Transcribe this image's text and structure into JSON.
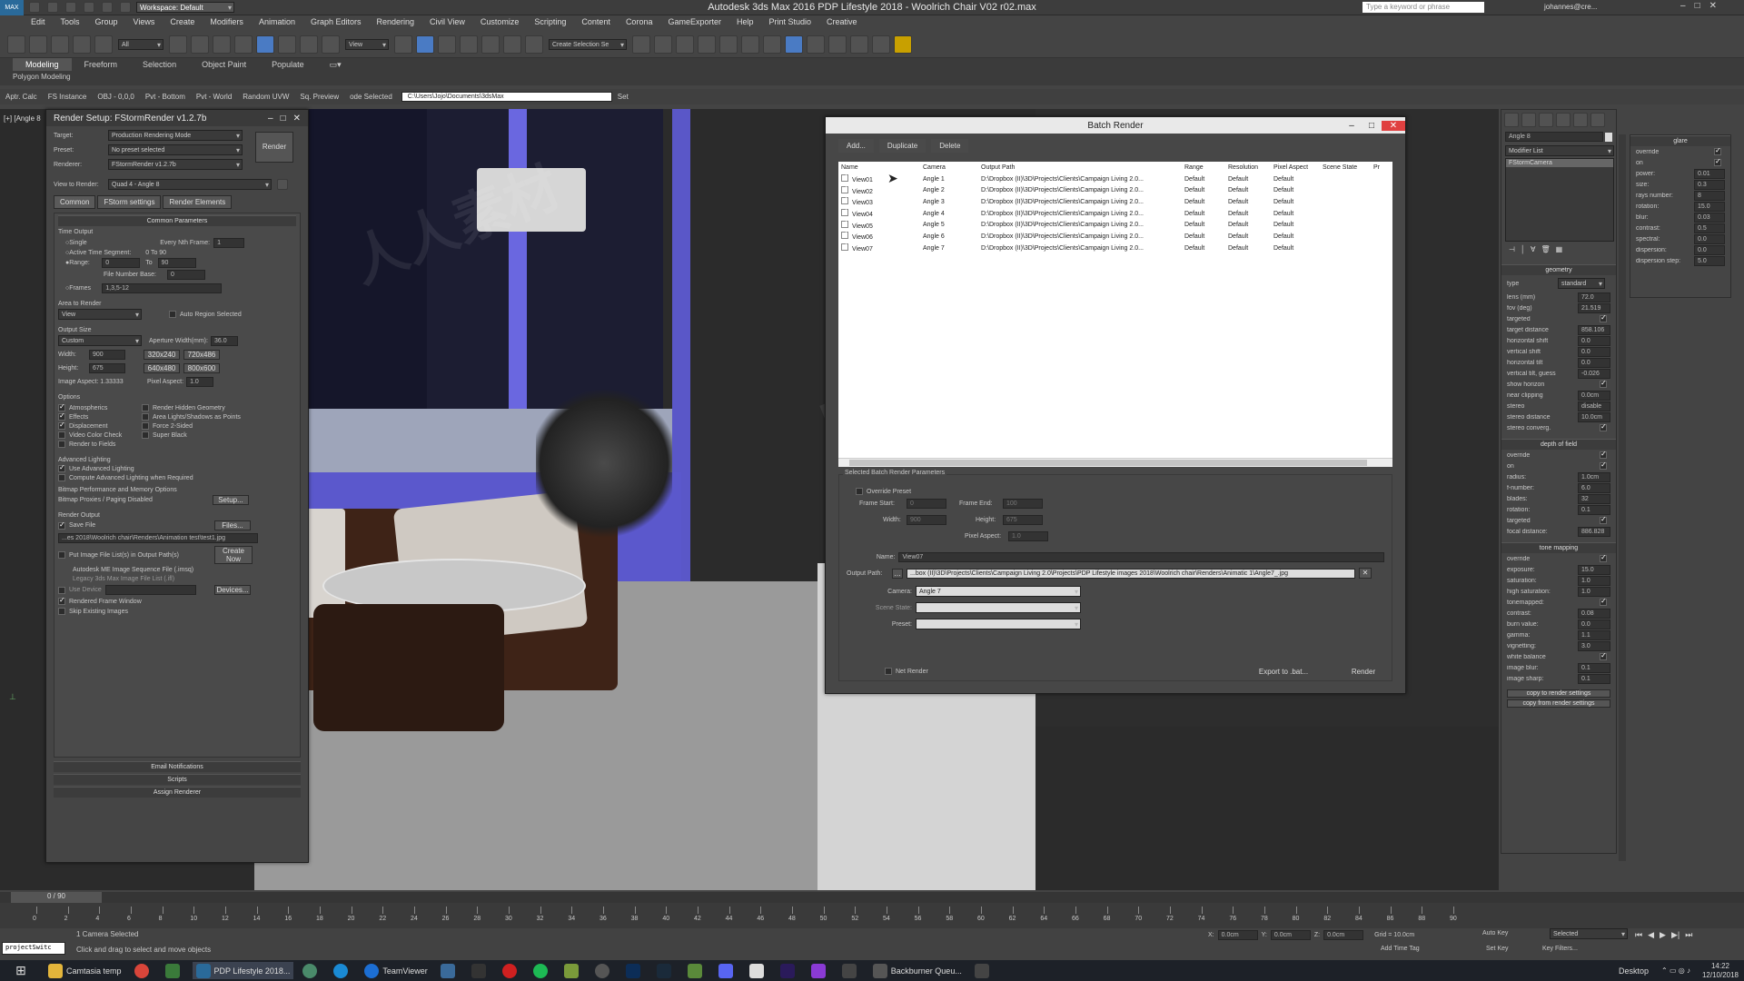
{
  "app": {
    "title": "Autodesk 3ds Max 2016    PDP Lifestyle 2018 - Woolrich Chair V02 r02.max",
    "workspace": "Workspace: Default",
    "search_placeholder": "Type a keyword or phrase",
    "user": "johannes@cre..."
  },
  "menu": [
    "Edit",
    "Tools",
    "Group",
    "Views",
    "Create",
    "Modifiers",
    "Animation",
    "Graph Editors",
    "Rendering",
    "Civil View",
    "Customize",
    "Scripting",
    "Content",
    "Corona",
    "GameExporter",
    "Help",
    "Print Studio",
    "Creative"
  ],
  "toolbar": {
    "filter": "All",
    "view": "View",
    "selection_set": "Create Selection Se"
  },
  "ribbon": {
    "tabs": [
      "Modeling",
      "Freeform",
      "Selection",
      "Object Paint",
      "Populate"
    ],
    "active": "Modeling",
    "sub": "Polygon Modeling",
    "row2": [
      "Aptr. Calc",
      "FS Instance",
      "OBJ - 0,0,0",
      "Pvt - Bottom",
      "Pvt - World",
      "Random UVW",
      "Sq. Preview",
      "ode Selected"
    ],
    "path": "C:\\Users\\Jojo\\Documents\\3dsMax",
    "set": "Set"
  },
  "viewport_label": "[+] [Angle 8",
  "render_setup": {
    "title": "Render Setup: FStormRender v1.2.7b",
    "target_label": "Target:",
    "target": "Production Rendering Mode",
    "preset_label": "Preset:",
    "preset": "No preset selected",
    "renderer_label": "Renderer:",
    "renderer": "FStormRender v1.2.7b",
    "view_label": "View to Render:",
    "view": "Quad 4 - Angle 8",
    "render_btn": "Render",
    "tabs": [
      "Common",
      "FStorm settings",
      "Render Elements"
    ],
    "common_params": "Common Parameters",
    "time_output": "Time Output",
    "single": "Single",
    "every_nth": "Every Nth Frame:",
    "every_nth_val": "1",
    "active_seg": "Active Time Segment:",
    "active_seg_val": "0 To 90",
    "range": "Range:",
    "range_from": "0",
    "range_to_lbl": "To",
    "range_to": "90",
    "file_num": "File Number Base:",
    "file_num_val": "0",
    "frames": "Frames",
    "frames_val": "1,3,5-12",
    "area": "Area to Render",
    "area_val": "View",
    "auto_region": "Auto Region Selected",
    "output_size": "Output Size",
    "output_preset": "Custom",
    "aperture": "Aperture Width(mm):",
    "aperture_val": "36.0",
    "width_lbl": "Width:",
    "width": "900",
    "height_lbl": "Height:",
    "height": "675",
    "presets": [
      "320x240",
      "720x486",
      "640x480",
      "800x600"
    ],
    "aspect": "Image Aspect: 1.33333",
    "pixel_aspect": "Pixel Aspect:",
    "pixel_aspect_val": "1.0",
    "options": "Options",
    "opt_left": [
      "Atmospherics",
      "Effects",
      "Displacement",
      "Video Color Check",
      "Render to Fields"
    ],
    "opt_right": [
      "Render Hidden Geometry",
      "Area Lights/Shadows as Points",
      "Force 2-Sided",
      "Super Black"
    ],
    "adv_light": "Advanced Lighting",
    "use_adv": "Use Advanced Lighting",
    "compute_adv": "Compute Advanced Lighting when Required",
    "bitmap": "Bitmap Performance and Memory Options",
    "bitmap_val": "Bitmap Proxies / Paging Disabled",
    "setup": "Setup...",
    "render_output": "Render Output",
    "save_file": "Save File",
    "files": "Files...",
    "output_file": "...es 2018\\Woolrich chair\\Renders\\Animation test\\test1.jpg",
    "put_image": "Put Image File List(s) in Output Path(s)",
    "create_now": "Create Now",
    "autodesk_seq": "Autodesk ME Image Sequence File (.imsq)",
    "legacy": "Legacy 3ds Max Image File List (.ifl)",
    "use_device": "Use Device",
    "devices": "Devices...",
    "rendered_fw": "Rendered Frame Window",
    "skip": "Skip Existing Images",
    "email": "Email Notifications",
    "scripts": "Scripts",
    "assign": "Assign Renderer"
  },
  "batch": {
    "title": "Batch Render",
    "buttons": [
      "Add...",
      "Duplicate",
      "Delete"
    ],
    "headers": [
      "Name",
      "Camera",
      "Output Path",
      "Range",
      "Resolution",
      "Pixel Aspect",
      "Scene State",
      "Pr"
    ],
    "rows": [
      [
        "View01",
        "Angle 1",
        "D:\\Dropbox (II)\\3D\\Projects\\Clients\\Campaign Living 2.0...",
        "Default",
        "Default",
        "Default"
      ],
      [
        "View02",
        "Angle 2",
        "D:\\Dropbox (II)\\3D\\Projects\\Clients\\Campaign Living 2.0...",
        "Default",
        "Default",
        "Default"
      ],
      [
        "View03",
        "Angle 3",
        "D:\\Dropbox (II)\\3D\\Projects\\Clients\\Campaign Living 2.0...",
        "Default",
        "Default",
        "Default"
      ],
      [
        "View04",
        "Angle 4",
        "D:\\Dropbox (II)\\3D\\Projects\\Clients\\Campaign Living 2.0...",
        "Default",
        "Default",
        "Default"
      ],
      [
        "View05",
        "Angle 5",
        "D:\\Dropbox (II)\\3D\\Projects\\Clients\\Campaign Living 2.0...",
        "Default",
        "Default",
        "Default"
      ],
      [
        "View06",
        "Angle 6",
        "D:\\Dropbox (II)\\3D\\Projects\\Clients\\Campaign Living 2.0...",
        "Default",
        "Default",
        "Default"
      ],
      [
        "View07",
        "Angle 7",
        "D:\\Dropbox (II)\\3D\\Projects\\Clients\\Campaign Living 2.0...",
        "Default",
        "Default",
        "Default"
      ]
    ],
    "params_title": "Selected Batch Render Parameters",
    "override": "Override Preset",
    "frame_start": "Frame Start:",
    "frame_start_val": "0",
    "frame_end": "Frame End:",
    "frame_end_val": "100",
    "width": "Width:",
    "width_val": "900",
    "height": "Height:",
    "height_val": "675",
    "pixel_aspect": "Pixel Aspect:",
    "pixel_aspect_val": "1.0",
    "name": "Name:",
    "name_val": "View07",
    "output": "Output Path:",
    "output_val": "...box (II)\\3D\\Projects\\Clients\\Campaign Living 2.0\\Projects\\PDP Lifestyle images 2018\\Woolrich chair\\Renders\\Animatic 1\\Angle7_.jpg",
    "camera": "Camera:",
    "camera_val": "Angle 7",
    "scene_state": "Scene State:",
    "preset": "Preset:",
    "net": "Net Render",
    "export": "Export to .bat...",
    "render": "Render"
  },
  "cmd_panel": {
    "name": "Angle 8",
    "modifier_list": "Modifier List",
    "stack": "FStormCamera",
    "geometry": "geometry",
    "type_lbl": "type",
    "type": "standard",
    "geo": [
      [
        "lens (mm)",
        "72.0"
      ],
      [
        "fov (deg)",
        "21.519"
      ],
      [
        "targeted",
        ""
      ],
      [
        "target distance",
        "858.106"
      ],
      [
        "horizontal shift",
        "0.0"
      ],
      [
        "vertical shift",
        "0.0"
      ],
      [
        "horizontal tilt",
        "0.0"
      ],
      [
        "vertical tilt, guess",
        "-0.026"
      ],
      [
        "show horizon",
        ""
      ],
      [
        "near clipping",
        "0.0cm"
      ],
      [
        "stereo",
        "disable"
      ],
      [
        "stereo distance",
        "10.0cm"
      ],
      [
        "stereo converg.",
        ""
      ]
    ],
    "dof": "depth of field",
    "dof_rows": [
      [
        "override",
        ""
      ],
      [
        "on",
        ""
      ],
      [
        "radius:",
        "1.0cm"
      ],
      [
        "f-number:",
        "6.0"
      ],
      [
        "blades:",
        "32"
      ],
      [
        "rotation:",
        "0.1"
      ],
      [
        "targeted",
        ""
      ],
      [
        "focal distance:",
        "886.828"
      ]
    ],
    "tone": "tone mapping",
    "tone_rows": [
      [
        "override",
        ""
      ],
      [
        "exposure:",
        "15.0"
      ],
      [
        "saturation:",
        "1.0"
      ],
      [
        "high saturation:",
        "1.0"
      ],
      [
        "tonemapped:",
        ""
      ],
      [
        "contrast:",
        "0.08"
      ],
      [
        "burn value:",
        "0.0"
      ],
      [
        "gamma:",
        "1.1"
      ],
      [
        "vignetting:",
        "3.0"
      ],
      [
        "white balance",
        ""
      ],
      [
        "image blur:",
        "0.1"
      ],
      [
        "image sharp:",
        "0.1"
      ]
    ],
    "copy_to": "copy to render settings",
    "copy_from": "copy from render settings"
  },
  "glare": {
    "title": "glare",
    "rows": [
      [
        "override",
        ""
      ],
      [
        "on",
        ""
      ],
      [
        "power:",
        "0.01"
      ],
      [
        "size:",
        "0.3"
      ],
      [
        "rays number:",
        "8"
      ],
      [
        "rotation:",
        "15.0"
      ],
      [
        "blur:",
        "0.03"
      ],
      [
        "contrast:",
        "0.5"
      ],
      [
        "spectral:",
        "0.0"
      ],
      [
        "dispersion:",
        "0.0"
      ],
      [
        "dispersion step:",
        "5.0"
      ]
    ]
  },
  "timeline": {
    "frame": "0 / 90",
    "ticks": [
      "0",
      "2",
      "4",
      "6",
      "8",
      "10",
      "12",
      "14",
      "16",
      "18",
      "20",
      "22",
      "24",
      "26",
      "28",
      "30",
      "32",
      "34",
      "36",
      "38",
      "40",
      "42",
      "44",
      "46",
      "48",
      "50",
      "52",
      "54",
      "56",
      "58",
      "60",
      "62",
      "64",
      "66",
      "68",
      "70",
      "72",
      "74",
      "76",
      "78",
      "80",
      "82",
      "84",
      "86",
      "88",
      "90"
    ]
  },
  "status": {
    "script": "projectSwitc",
    "selected": "1 Camera Selected",
    "hint": "Click and drag to select and move objects",
    "x": "0.0cm",
    "y": "0.0cm",
    "z": "0.0cm",
    "grid": "Grid = 10.0cm",
    "add_time_tag": "Add Time Tag",
    "auto_key": "Auto Key",
    "set_key": "Set Key",
    "selected_val": "Selected",
    "key_filters": "Key Filters..."
  },
  "taskbar": {
    "items": [
      "Camtasia temp",
      "PDP Lifestyle 2018...",
      "TeamViewer",
      "Backburner Queu..."
    ],
    "desktop": "Desktop",
    "time": "14:22",
    "date": "12/10/2018"
  }
}
